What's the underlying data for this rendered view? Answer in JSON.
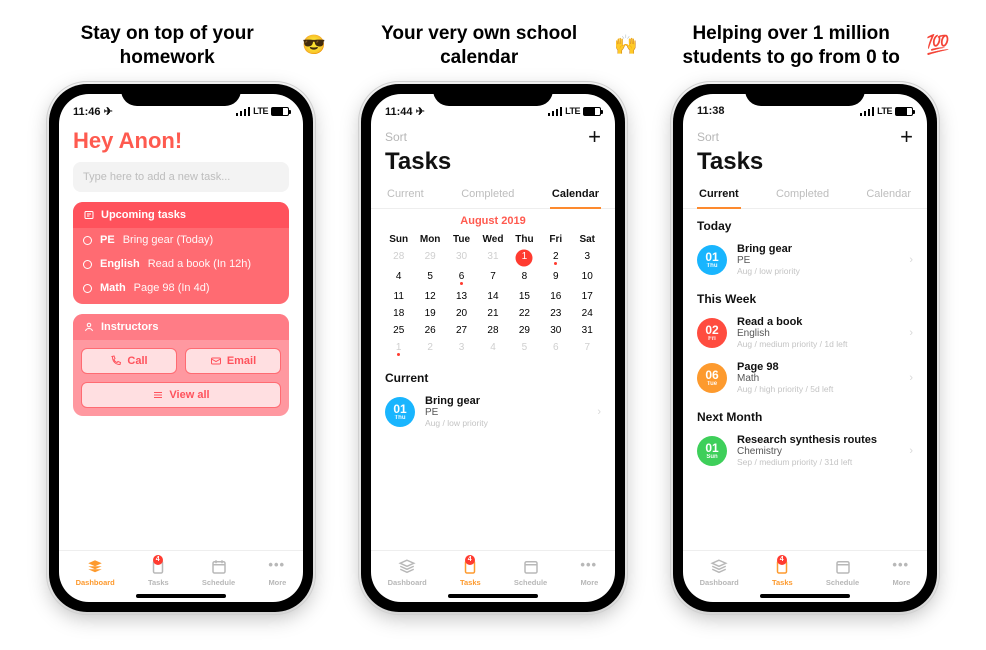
{
  "panels": [
    {
      "headline": "Stay on top of your homework",
      "emoji": "😎"
    },
    {
      "headline": "Your very own school calendar",
      "emoji": "🙌"
    },
    {
      "headline": "Helping over 1 million students to go from 0 to",
      "emoji": "💯"
    }
  ],
  "phone1": {
    "time": "11:46 ✈︎",
    "net": "LTE",
    "greeting": "Hey Anon!",
    "placeholder": "Type here to add a new task...",
    "upcoming_label": "Upcoming tasks",
    "tasks": [
      {
        "subject": "PE",
        "text": "Bring gear (Today)"
      },
      {
        "subject": "English",
        "text": "Read a book (In 12h)"
      },
      {
        "subject": "Math",
        "text": "Page 98 (In 4d)"
      }
    ],
    "instructors_label": "Instructors",
    "btn_call": "Call",
    "btn_email": "Email",
    "btn_viewall": "View all"
  },
  "phone2": {
    "time": "11:44 ✈︎",
    "net": "LTE",
    "sort": "Sort",
    "title": "Tasks",
    "tabs": [
      "Current",
      "Completed",
      "Calendar"
    ],
    "active_tab": "Calendar",
    "cal_title": "August 2019",
    "dow": [
      "Sun",
      "Mon",
      "Tue",
      "Wed",
      "Thu",
      "Fri",
      "Sat"
    ],
    "rows": [
      [
        "28",
        "29",
        "30",
        "31",
        "1",
        "2",
        "3"
      ],
      [
        "4",
        "5",
        "6",
        "7",
        "8",
        "9",
        "10"
      ],
      [
        "11",
        "12",
        "13",
        "14",
        "15",
        "16",
        "17"
      ],
      [
        "18",
        "19",
        "20",
        "21",
        "22",
        "23",
        "24"
      ],
      [
        "25",
        "26",
        "27",
        "28",
        "29",
        "30",
        "31"
      ],
      [
        "1",
        "2",
        "3",
        "4",
        "5",
        "6",
        "7"
      ]
    ],
    "current_label": "Current",
    "item": {
      "day": "01",
      "dow": "Thu",
      "title": "Bring gear",
      "sub": "PE",
      "meta": "Aug / low priority"
    }
  },
  "phone3": {
    "time": "11:38",
    "net": "LTE",
    "sort": "Sort",
    "title": "Tasks",
    "tabs": [
      "Current",
      "Completed",
      "Calendar"
    ],
    "active_tab": "Current",
    "sections": [
      {
        "label": "Today",
        "items": [
          {
            "day": "01",
            "dow": "Thu",
            "color": "b-blue",
            "title": "Bring gear",
            "sub": "PE",
            "meta": "Aug / low priority"
          }
        ]
      },
      {
        "label": "This Week",
        "items": [
          {
            "day": "02",
            "dow": "Fri",
            "color": "b-red",
            "title": "Read a book",
            "sub": "English",
            "meta": "Aug / medium priority / 1d left"
          },
          {
            "day": "06",
            "dow": "Tue",
            "color": "b-orange",
            "title": "Page 98",
            "sub": "Math",
            "meta": "Aug / high priority / 5d left"
          }
        ]
      },
      {
        "label": "Next Month",
        "items": [
          {
            "day": "01",
            "dow": "Sun",
            "color": "b-green",
            "title": "Research synthesis routes",
            "sub": "Chemistry",
            "meta": "Sep / medium priority / 31d left"
          }
        ]
      }
    ]
  },
  "tabbar": {
    "items": [
      "Dashboard",
      "Tasks",
      "Schedule",
      "More"
    ],
    "badge": "4"
  }
}
